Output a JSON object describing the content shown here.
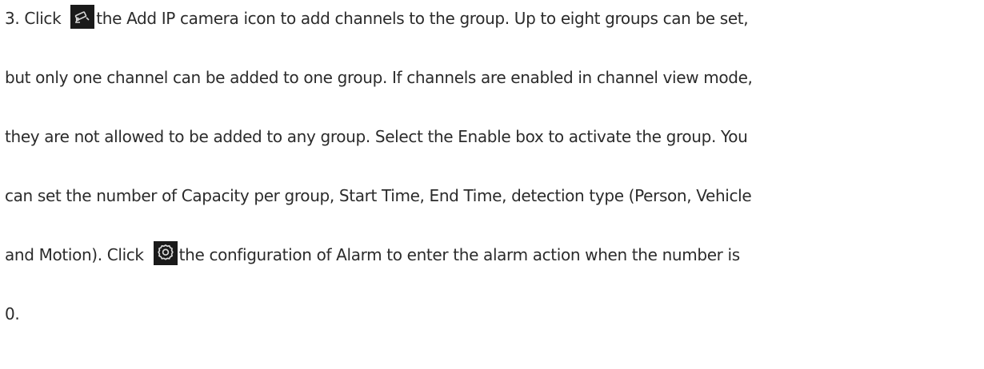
{
  "document": {
    "paragraph": {
      "line1_prefix": "3. Click",
      "line1_suffix": "the Add IP camera icon to add channels to the group. Up to eight groups can be set,",
      "line2": "but only one channel can be added to one group. If channels are enabled in channel view mode,",
      "line3": "they are not allowed to be added to any group. Select the Enable box to activate the group. You",
      "line4": "can set the number of Capacity per group, Start Time, End Time, detection type (Person, Vehicle",
      "line5_prefix": "and Motion). Click",
      "line5_suffix": "the configuration of Alarm to enter the alarm action when the number is",
      "line6": "0."
    },
    "icons": {
      "add_ip_camera": "add-ip-camera-icon",
      "alarm_config": "gear-icon"
    }
  }
}
